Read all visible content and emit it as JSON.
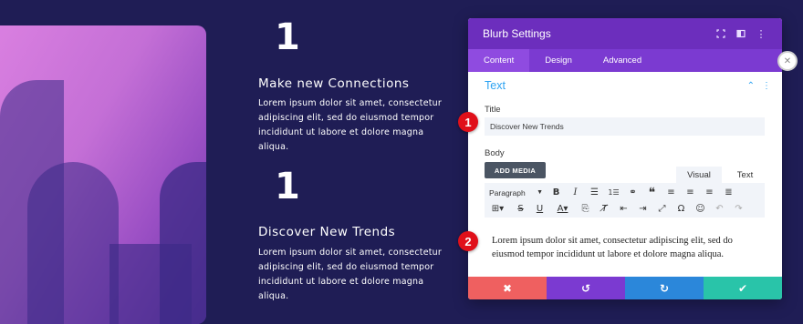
{
  "left": {
    "blocks": [
      {
        "numeral": "1",
        "heading": "Make new Connections",
        "text_lines": [
          "Lorem ipsum dolor sit amet, consectetur",
          "adipiscing elit, sed do eiusmod tempor",
          "incididunt ut labore et dolore magna aliqua."
        ]
      },
      {
        "numeral": "1",
        "heading": "Discover New Trends",
        "text_lines": [
          "Lorem ipsum dolor sit amet, consectetur",
          "adipiscing elit, sed do eiusmod tempor",
          "incididunt ut labore et dolore magna aliqua."
        ]
      }
    ]
  },
  "panel": {
    "title": "Blurb Settings",
    "header_icons": [
      "expand-icon",
      "split-view-icon",
      "more-options-icon"
    ],
    "tabs": [
      {
        "label": "Content",
        "active": true
      },
      {
        "label": "Design",
        "active": false
      },
      {
        "label": "Advanced",
        "active": false
      }
    ],
    "section": {
      "label": "Text"
    },
    "title_field": {
      "label": "Title",
      "value": "Discover New Trends"
    },
    "body_field": {
      "label": "Body",
      "add_media": "ADD MEDIA",
      "editor_tabs": [
        {
          "label": "Visual",
          "active": true
        },
        {
          "label": "Text",
          "active": false
        }
      ],
      "format_select": "Paragraph",
      "content_lines": [
        "Lorem ipsum dolor sit amet, consectetur adipiscing elit, sed do",
        "eiusmod tempor incididunt ut labore et dolore magna aliqua."
      ]
    },
    "footer": {
      "cancel_icon": "close-icon",
      "undo_icon": "undo-icon",
      "redo_icon": "redo-icon",
      "save_icon": "check-icon",
      "colors": {
        "cancel": "#ef6060",
        "undo": "#7b3ad1",
        "redo": "#2b87da",
        "save": "#29c4a9"
      }
    }
  },
  "markers": [
    "1",
    "2"
  ],
  "colors": {
    "background": "#1f1d55",
    "accent": "#2ea3f2",
    "header": "#6c2ebd",
    "marker": "#e0101a"
  }
}
